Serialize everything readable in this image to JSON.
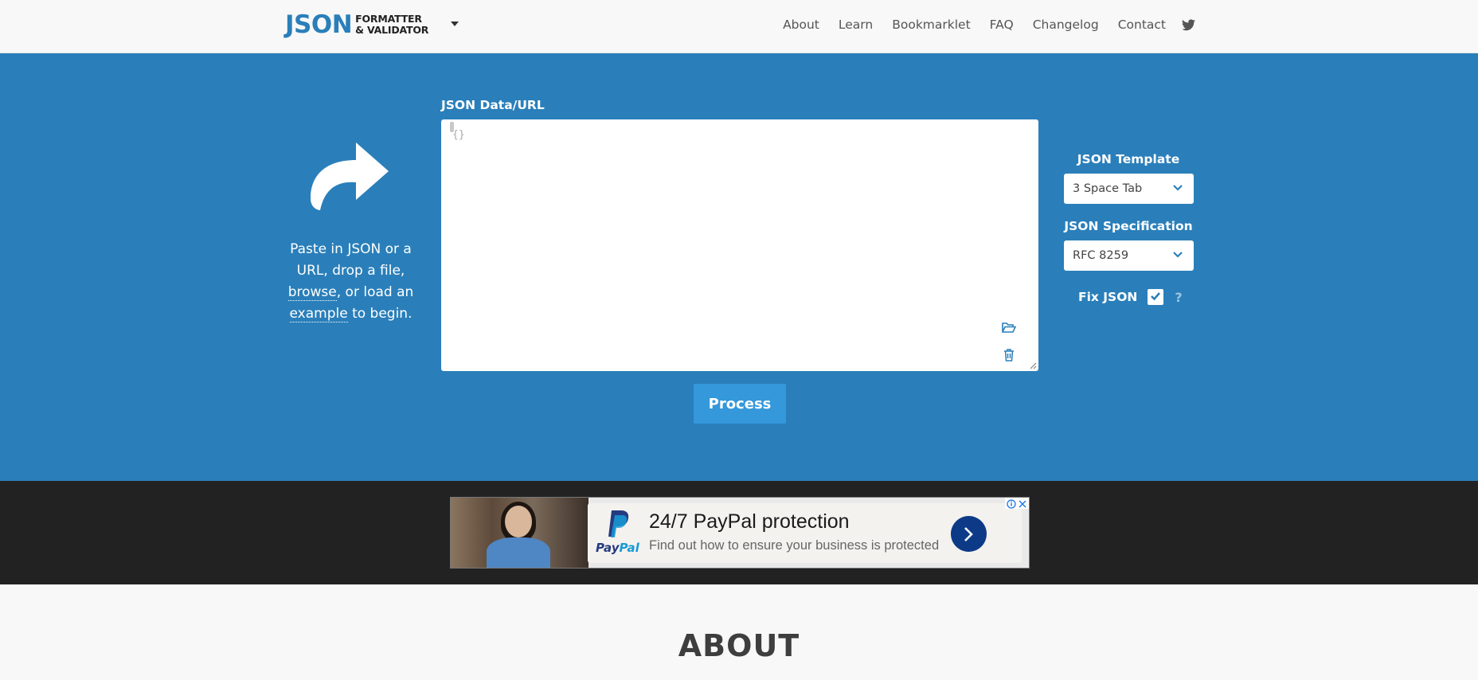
{
  "header": {
    "logo_main": "JSON",
    "logo_line1": "FORMATTER",
    "logo_line2": "& VALIDATOR",
    "nav": [
      "About",
      "Learn",
      "Bookmarklet",
      "FAQ",
      "Changelog",
      "Contact"
    ]
  },
  "hero": {
    "hint_pre": "Paste in JSON or a URL, drop a file, ",
    "hint_browse": "browse",
    "hint_mid": ", or load an ",
    "hint_example": "example",
    "hint_post": " to begin.",
    "data_label": "JSON Data/URL",
    "editor_placeholder": "{}",
    "process_label": "Process"
  },
  "options": {
    "template_label": "JSON Template",
    "template_value": "3 Space Tab",
    "spec_label": "JSON Specification",
    "spec_value": "RFC 8259",
    "fix_label": "Fix JSON",
    "fix_checked": true,
    "help": "?"
  },
  "ad": {
    "title": "24/7 PayPal protection",
    "description": "Find out how to ensure your business is protected",
    "brand_pay": "Pay",
    "brand_pal": "Pal"
  },
  "about": {
    "title": "ABOUT"
  },
  "colors": {
    "accent": "#2a7fba",
    "button": "#3498db",
    "ad_band": "#222222"
  },
  "icons": [
    "caret-down-icon",
    "twitter-icon",
    "redirect-arrow-icon",
    "folder-open-icon",
    "trash-icon",
    "chevron-down-icon",
    "checkmark-icon",
    "paypal-logo",
    "chevron-right-icon",
    "adchoices-icon"
  ]
}
